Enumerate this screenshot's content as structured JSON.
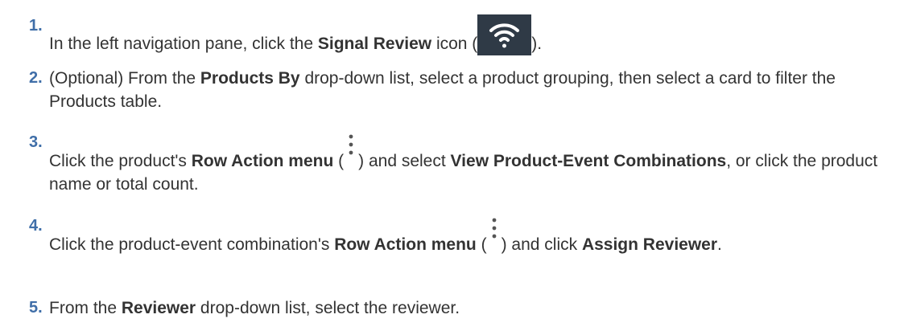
{
  "steps": [
    {
      "number": "1.",
      "t1": "In the left navigation pane, click the ",
      "b1": "Signal Review",
      "t2": " icon (",
      "icon": "wifi-signal-icon",
      "t3": ")."
    },
    {
      "number": "2.",
      "t1": "(Optional) From the ",
      "b1": "Products By",
      "t2": " drop-down list, select a product grouping, then select a card to filter the Products table."
    },
    {
      "number": "3.",
      "t1": "Click the product's ",
      "b1": "Row Action menu",
      "t2": " (",
      "icon": "vertical-ellipsis-icon",
      "t3": ") and select ",
      "b2": "View Product-Event Combinations",
      "t4": ", or click the product name or total count."
    },
    {
      "number": "4.",
      "t1": "Click the product-event combination's ",
      "b1": "Row Action menu",
      "t2": " (",
      "icon": "vertical-ellipsis-icon",
      "t3": ") and click ",
      "b2": "Assign Reviewer",
      "t4": "."
    },
    {
      "number": "5.",
      "t1": "From the ",
      "b1": "Reviewer",
      "t2": " drop-down list, select the reviewer."
    }
  ],
  "colors": {
    "text": "#333333",
    "step_number": "#3f6ea8",
    "icon_bg": "#2f3a46"
  }
}
